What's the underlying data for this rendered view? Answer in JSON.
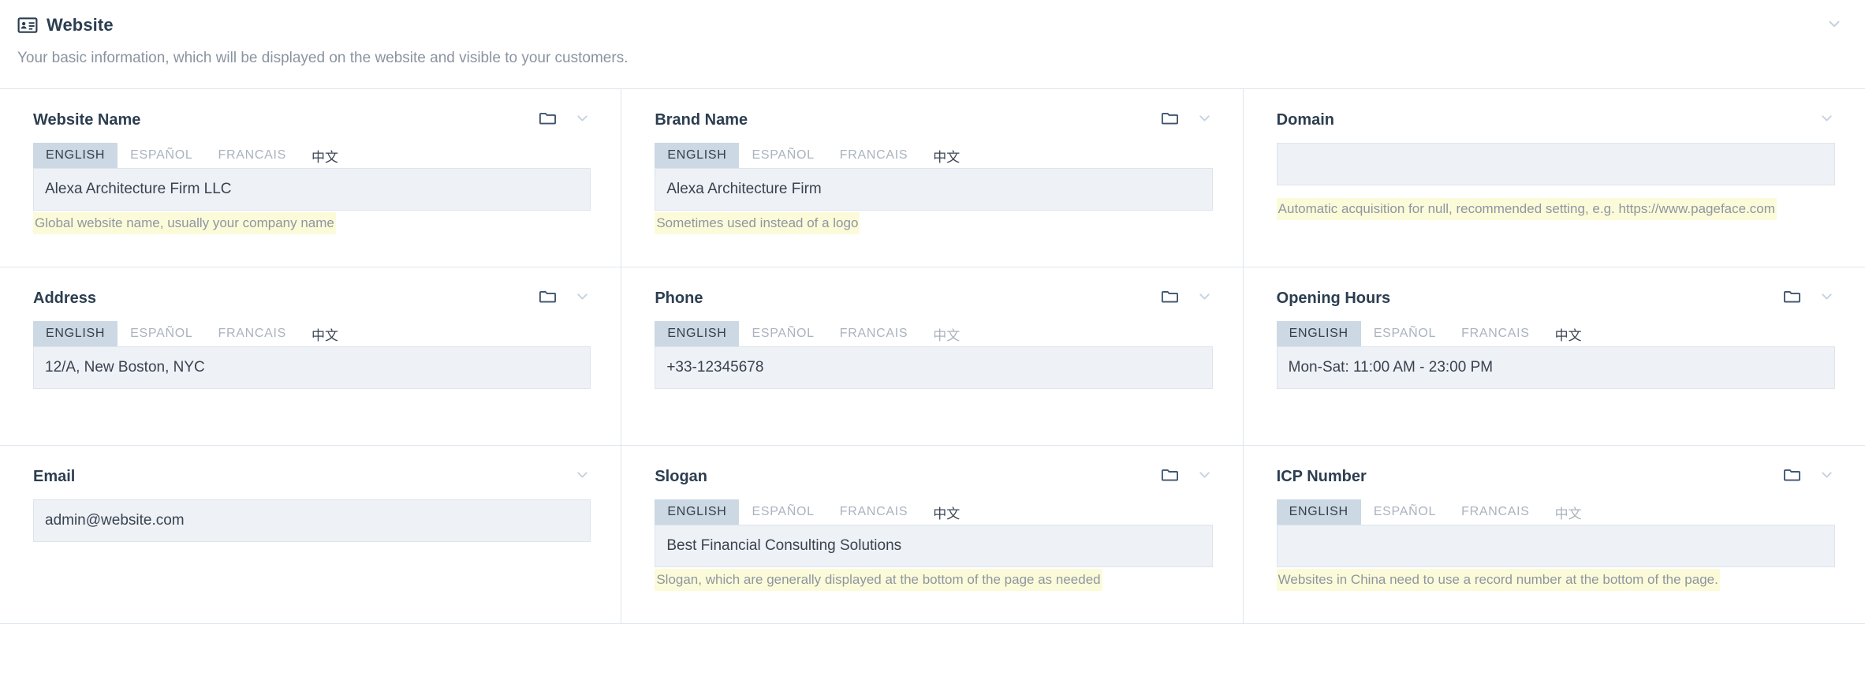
{
  "header": {
    "icon": "id-card-icon",
    "title": "Website",
    "collapse_icon": "chevron-down-icon",
    "description": "Your basic information, which will be displayed on the website and visible to your customers."
  },
  "languages": [
    "ENGLISH",
    "ESPAÑOL",
    "FRANCAIS",
    "中文"
  ],
  "colors": {
    "title": "#2c3e50",
    "muted": "#8a93a0",
    "tab_active_bg": "#ccd8e3",
    "field_bg": "#eef1f6",
    "hint_bg": "#fcfbd9",
    "border": "#dfe6ee"
  },
  "cards": [
    {
      "title": "Website Name",
      "has_folder": true,
      "folder_icon": "folder-icon",
      "chevron_icon": "chevron-down-icon",
      "has_tabs": true,
      "active_lang": "ENGLISH",
      "cjk_dim": false,
      "value": "Alexa Architecture Firm LLC",
      "hint": "Global website name, usually your company name"
    },
    {
      "title": "Brand Name",
      "has_folder": true,
      "folder_icon": "folder-icon",
      "chevron_icon": "chevron-down-icon",
      "has_tabs": true,
      "active_lang": "ENGLISH",
      "cjk_dim": false,
      "value": "Alexa Architecture Firm",
      "hint": "Sometimes used instead of a logo"
    },
    {
      "title": "Domain",
      "has_folder": false,
      "folder_icon": "",
      "chevron_icon": "chevron-down-icon",
      "has_tabs": false,
      "active_lang": "",
      "cjk_dim": false,
      "value": "",
      "hint": "Automatic acquisition for null, recommended setting, e.g. https://www.pageface.com"
    },
    {
      "title": "Address",
      "has_folder": true,
      "folder_icon": "folder-icon",
      "chevron_icon": "chevron-down-icon",
      "has_tabs": true,
      "active_lang": "ENGLISH",
      "cjk_dim": false,
      "value": "12/A, New Boston, NYC",
      "hint": ""
    },
    {
      "title": "Phone",
      "has_folder": true,
      "folder_icon": "folder-icon",
      "chevron_icon": "chevron-down-icon",
      "has_tabs": true,
      "active_lang": "ENGLISH",
      "cjk_dim": true,
      "value": "+33-12345678",
      "hint": ""
    },
    {
      "title": "Opening Hours",
      "has_folder": true,
      "folder_icon": "folder-icon",
      "chevron_icon": "chevron-down-icon",
      "has_tabs": true,
      "active_lang": "ENGLISH",
      "cjk_dim": false,
      "value": "Mon-Sat: 11:00 AM - 23:00 PM",
      "hint": ""
    },
    {
      "title": "Email",
      "has_folder": false,
      "folder_icon": "",
      "chevron_icon": "chevron-down-icon",
      "has_tabs": false,
      "active_lang": "",
      "cjk_dim": false,
      "value": "admin@website.com",
      "hint": ""
    },
    {
      "title": "Slogan",
      "has_folder": true,
      "folder_icon": "folder-icon",
      "chevron_icon": "chevron-down-icon",
      "has_tabs": true,
      "active_lang": "ENGLISH",
      "cjk_dim": false,
      "value": "Best Financial Consulting Solutions",
      "hint": "Slogan, which are generally displayed at the bottom of the page as needed"
    },
    {
      "title": "ICP Number",
      "has_folder": true,
      "folder_icon": "folder-icon",
      "chevron_icon": "chevron-down-icon",
      "has_tabs": true,
      "active_lang": "ENGLISH",
      "cjk_dim": true,
      "value": "",
      "hint": "Websites in China need to use a record number at the bottom of the page."
    }
  ]
}
